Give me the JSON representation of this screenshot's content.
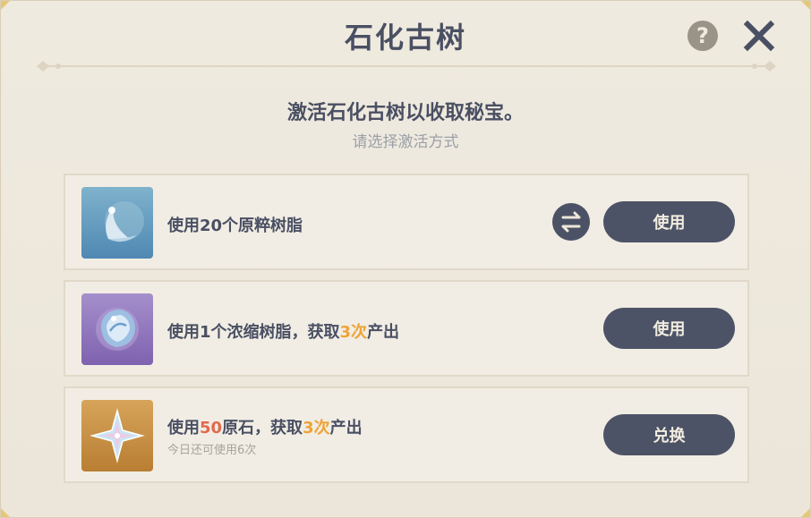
{
  "dialog": {
    "title": "石化古树",
    "help_label": "?",
    "headline": "激活石化古树以收取秘宝。",
    "subline": "请选择激活方式"
  },
  "options": [
    {
      "icon": "original-resin-icon",
      "text_parts": [
        "使用20个原粹树脂"
      ],
      "button": "使用",
      "has_swap": true
    },
    {
      "icon": "condensed-resin-icon",
      "text_parts": [
        "使用1个浓缩树脂，获取",
        "3次",
        "产出"
      ],
      "button": "使用"
    },
    {
      "icon": "primogem-icon",
      "text_parts": [
        "使用",
        "50",
        "原石，获取",
        "3次",
        "产出"
      ],
      "subtext": "今日还可使用6次",
      "button": "兑换"
    }
  ],
  "colors": {
    "accent_orange": "#eea338",
    "accent_red": "#e2694d",
    "text_dark": "#4a5063",
    "button_bg": "#4d5366"
  }
}
